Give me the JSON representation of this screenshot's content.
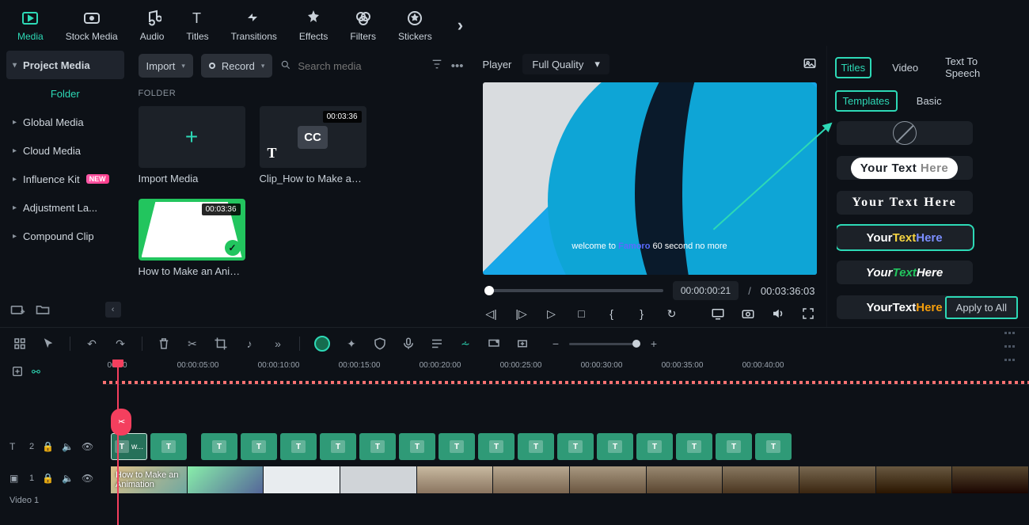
{
  "topnav": {
    "tabs": [
      "Media",
      "Stock Media",
      "Audio",
      "Titles",
      "Transitions",
      "Effects",
      "Filters",
      "Stickers"
    ],
    "active": 0
  },
  "library": {
    "header": "Project Media",
    "folder_label": "Folder",
    "items": [
      "Global Media",
      "Cloud Media",
      "Influence Kit",
      "Adjustment La...",
      "Compound Clip"
    ],
    "new_badge_on": 2
  },
  "browser": {
    "import_label": "Import",
    "record_label": "Record",
    "search_placeholder": "Search media",
    "folder_label": "FOLDER",
    "items": [
      {
        "caption": "Import Media"
      },
      {
        "caption": "Clip_How to Make an ...",
        "duration": "00:03:36",
        "cc": true
      },
      {
        "caption": "How to Make an Anim...",
        "duration": "00:03:36"
      }
    ]
  },
  "player": {
    "label": "Player",
    "quality": "Full Quality",
    "caption_pre": "welcome to ",
    "caption_brand": "Famoro",
    "caption_post": " 60 second no more",
    "time_current": "00:00:00:21",
    "time_total": "00:03:36:03"
  },
  "inspector": {
    "tabs": [
      "Titles",
      "Video",
      "Text To Speech"
    ],
    "active_tab": 0,
    "subtabs": [
      "Templates",
      "Basic"
    ],
    "active_sub": 0,
    "tpl_text": "Your Text Here",
    "apply_label": "Apply to All"
  },
  "timeline": {
    "ruler": [
      "00:00",
      "00:00:05:00",
      "00:00:10:00",
      "00:00:15:00",
      "00:00:20:00",
      "00:00:25:00",
      "00:00:30:00",
      "00:00:35:00",
      "00:00:40:00"
    ],
    "track_title_icon_label": "T",
    "track_title_count": "2",
    "track_video_count": "1",
    "first_title_clip_text": "w...",
    "video_clip_label": "How to Make an Animation",
    "video_track_label": "Video 1"
  }
}
